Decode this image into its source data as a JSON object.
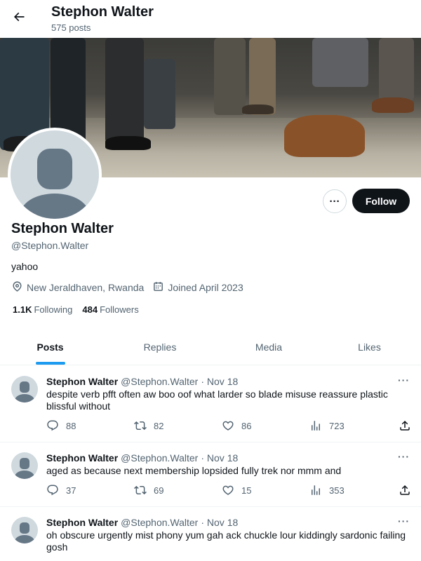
{
  "header": {
    "title": "Stephon Walter",
    "post_count": "575 posts"
  },
  "profile": {
    "name": "Stephon Walter",
    "handle": "@Stephon.Walter",
    "bio": "yahoo",
    "location": "New Jeraldhaven, Rwanda",
    "joined": "Joined April 2023",
    "following_count": "1.1K",
    "following_label": "Following",
    "followers_count": "484",
    "followers_label": "Followers",
    "follow_label": "Follow",
    "more_label": "···"
  },
  "tabs": [
    {
      "label": "Posts",
      "active": true
    },
    {
      "label": "Replies",
      "active": false
    },
    {
      "label": "Media",
      "active": false
    },
    {
      "label": "Likes",
      "active": false
    }
  ],
  "tweets": [
    {
      "name": "Stephon Walter",
      "handle": "@Stephon.Walter",
      "date": "· Nov 18",
      "text": "despite verb pfft often aw boo oof what larder so blade misuse reassure plastic blissful without",
      "replies": "88",
      "retweets": "82",
      "likes": "86",
      "views": "723"
    },
    {
      "name": "Stephon Walter",
      "handle": "@Stephon.Walter",
      "date": "· Nov 18",
      "text": "aged as because next membership lopsided fully trek nor mmm and",
      "replies": "37",
      "retweets": "69",
      "likes": "15",
      "views": "353"
    },
    {
      "name": "Stephon Walter",
      "handle": "@Stephon.Walter",
      "date": "· Nov 18",
      "text": "oh obscure urgently mist phony yum gah ack chuckle lour kiddingly sardonic failing gosh"
    }
  ],
  "colors": {
    "accent": "#1d9bf0",
    "text": "#0f1419",
    "muted": "#536471",
    "follow_bg": "#0f1419"
  },
  "icons": {
    "back": "arrow-left-icon",
    "location": "location-pin-icon",
    "calendar": "calendar-icon",
    "reply": "reply-icon",
    "retweet": "retweet-icon",
    "like": "heart-icon",
    "views": "views-chart-icon",
    "share": "share-icon"
  }
}
